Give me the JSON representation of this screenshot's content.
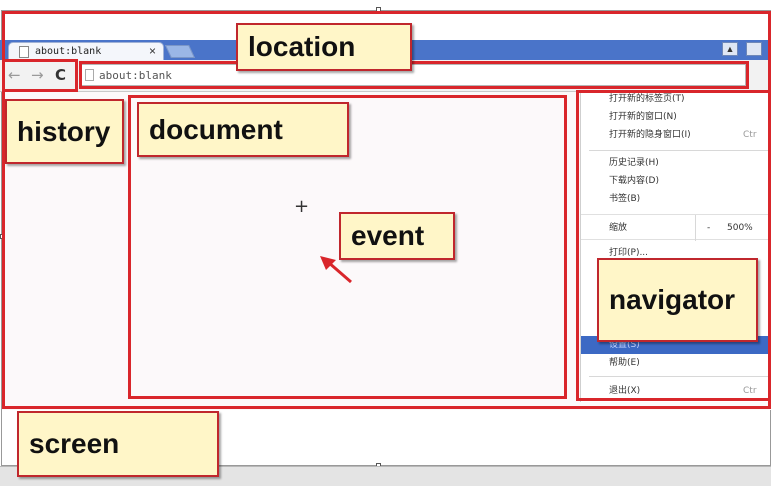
{
  "browser": {
    "tab_title": "about:blank",
    "tab_close": "×",
    "url": "about:blank",
    "back_glyph": "←",
    "forward_glyph": "→",
    "reload_glyph": "C",
    "crosshair_glyph": "+",
    "window_button_glyph": "▲"
  },
  "context_menu": {
    "items": [
      {
        "label": "打开新的标签页(T)",
        "shortcut": ""
      },
      {
        "label": "打开新的窗口(N)",
        "shortcut": ""
      },
      {
        "label": "打开新的隐身窗口(I)",
        "shortcut": "Ctr"
      },
      {
        "label": "历史记录(H)",
        "shortcut": ""
      },
      {
        "label": "下载内容(D)",
        "shortcut": ""
      },
      {
        "label": "书签(B)",
        "shortcut": ""
      },
      {
        "label": "打印(P)...",
        "shortcut": ""
      },
      {
        "label": "设置(S)",
        "shortcut": ""
      },
      {
        "label": "帮助(E)",
        "shortcut": ""
      },
      {
        "label": "退出(X)",
        "shortcut": "Ctr"
      }
    ],
    "zoom": {
      "label": "缩放",
      "minus": "-",
      "value": "500%"
    }
  },
  "annotations": {
    "location": "location",
    "history": "history",
    "document": "document",
    "event": "event",
    "navigator": "navigator",
    "screen": "screen"
  },
  "colors": {
    "annotation_border": "#d9262b",
    "note_background": "#fff6c8",
    "titlebar": "#4a74c9",
    "menu_selected": "#3c69c4"
  },
  "icons": {
    "tab": "page-icon",
    "omnibox": "page-icon",
    "window": "user-icon"
  }
}
